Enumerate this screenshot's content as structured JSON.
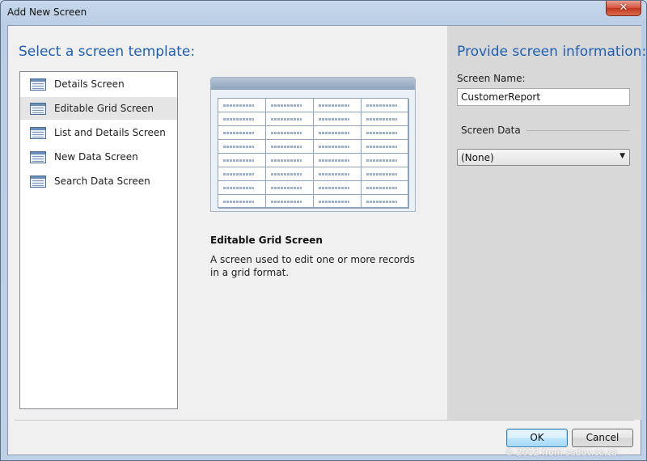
{
  "window": {
    "title": "Add New Screen",
    "close_icon": "close-icon"
  },
  "left": {
    "heading": "Select a screen template:",
    "templates": [
      {
        "label": "Details Screen",
        "icon": "screen-template-icon",
        "selected": false
      },
      {
        "label": "Editable Grid Screen",
        "icon": "screen-template-icon",
        "selected": true
      },
      {
        "label": "List and Details Screen",
        "icon": "screen-template-icon",
        "selected": false
      },
      {
        "label": "New Data Screen",
        "icon": "screen-template-icon",
        "selected": false
      },
      {
        "label": "Search Data Screen",
        "icon": "screen-template-icon",
        "selected": false
      }
    ],
    "description_title": "Editable Grid Screen",
    "description_text": "A screen used to edit one or more records in a grid format."
  },
  "right": {
    "heading": "Provide screen information:",
    "screen_name_label": "Screen Name:",
    "screen_name_value": "CustomerReport",
    "screen_data_label": "Screen Data",
    "screen_data_value": "(None)"
  },
  "footer": {
    "ok_label": "OK",
    "cancel_label": "Cancel",
    "watermark": "© 2012 from sadev.co.za"
  },
  "colors": {
    "heading": "#1f5fb0",
    "selection": "#e5e5e5",
    "right_panel": "#d8d8d8"
  }
}
